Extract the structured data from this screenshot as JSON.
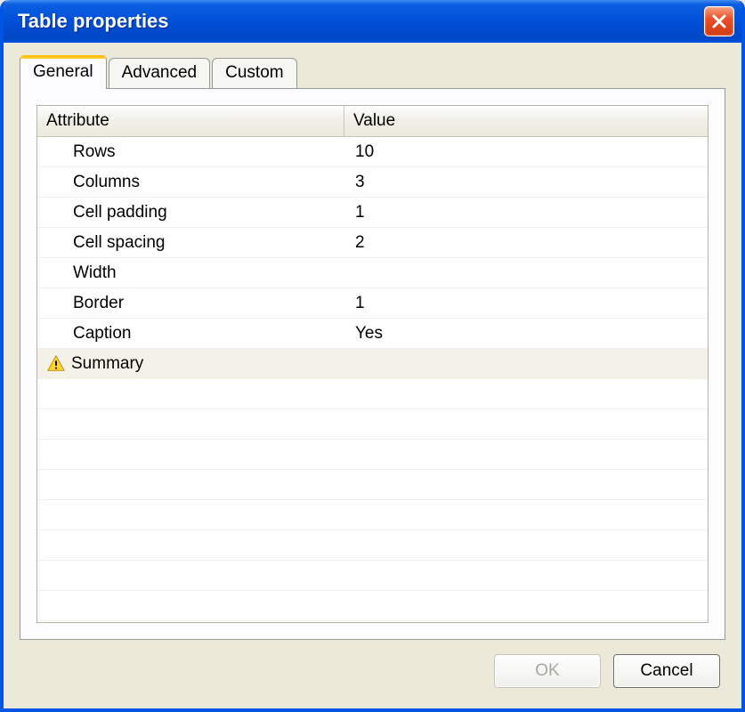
{
  "window": {
    "title": "Table properties"
  },
  "tabs": [
    {
      "label": "General",
      "active": true
    },
    {
      "label": "Advanced",
      "active": false
    },
    {
      "label": "Custom",
      "active": false
    }
  ],
  "grid": {
    "headers": {
      "attribute": "Attribute",
      "value": "Value"
    },
    "rows": [
      {
        "attr": "Rows",
        "val": "10",
        "warning": false
      },
      {
        "attr": "Columns",
        "val": "3",
        "warning": false
      },
      {
        "attr": "Cell padding",
        "val": "1",
        "warning": false
      },
      {
        "attr": "Cell spacing",
        "val": "2",
        "warning": false
      },
      {
        "attr": "Width",
        "val": "",
        "warning": false
      },
      {
        "attr": "Border",
        "val": "1",
        "warning": false
      },
      {
        "attr": "Caption",
        "val": "Yes",
        "warning": false
      },
      {
        "attr": "Summary",
        "val": "",
        "warning": true
      }
    ]
  },
  "buttons": {
    "ok": "OK",
    "cancel": "Cancel"
  }
}
